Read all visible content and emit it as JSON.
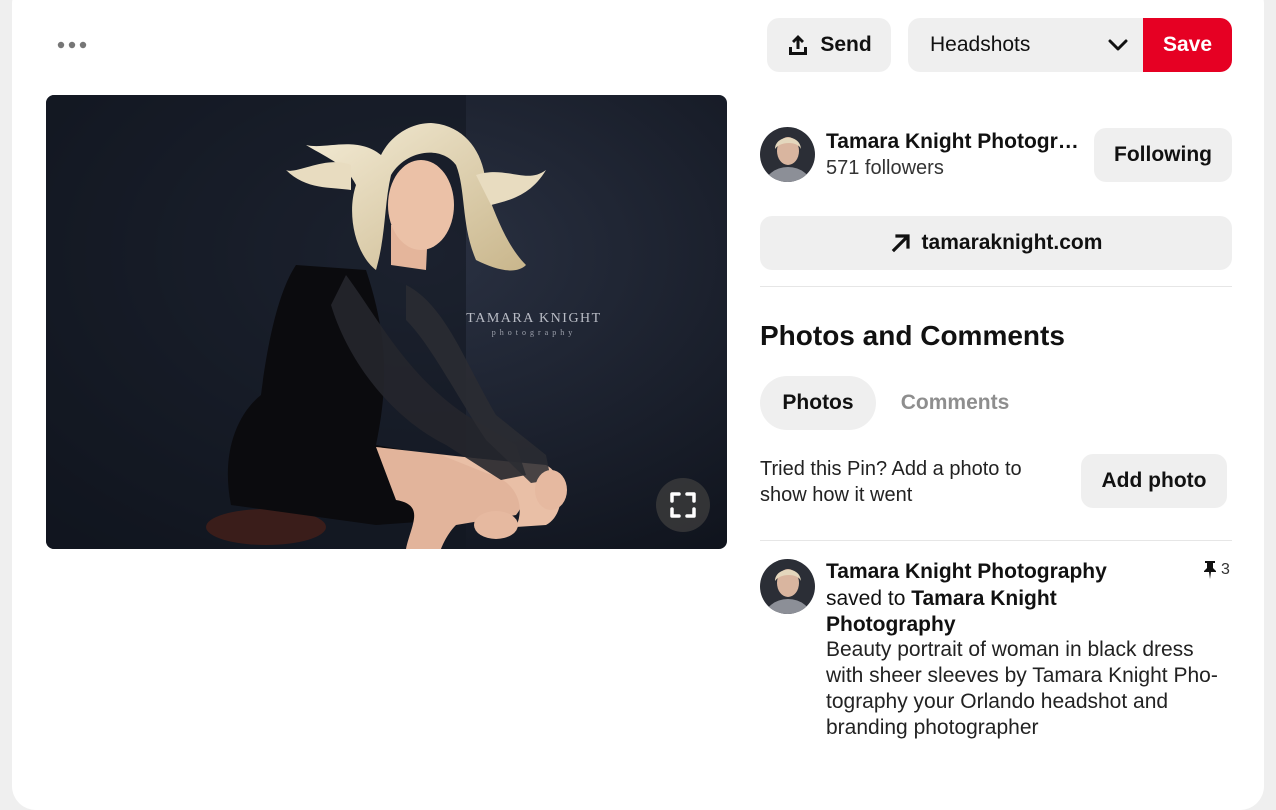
{
  "header": {
    "send_label": "Send",
    "board_selected": "Headshots",
    "save_label": "Save"
  },
  "image": {
    "watermark_line1": "TAMARA KNIGHT",
    "watermark_line2": "photography"
  },
  "creator": {
    "name": "Tamara Knight Photography",
    "followers": "571 followers",
    "follow_label": "Following"
  },
  "link": {
    "label": "tamaraknight.com"
  },
  "photos_section": {
    "title": "Photos and Comments",
    "tab_photos": "Photos",
    "tab_comments": "Comments",
    "prompt": "Tried this Pin? Add a photo to show how it went",
    "add_photo_label": "Add photo"
  },
  "activity": {
    "user_name": "Tamara Knight Photography",
    "saved_to_prefix": "saved to",
    "board_name": "Tamara Knight Photography",
    "pin_count": "3",
    "description": "Beauty portrait of woman in black dress with sheer sleeves by Tamara Knight Pho-tography your Orlando headshot and branding photographer"
  },
  "colors": {
    "save_red": "#e60023",
    "button_gray": "#efefef"
  }
}
